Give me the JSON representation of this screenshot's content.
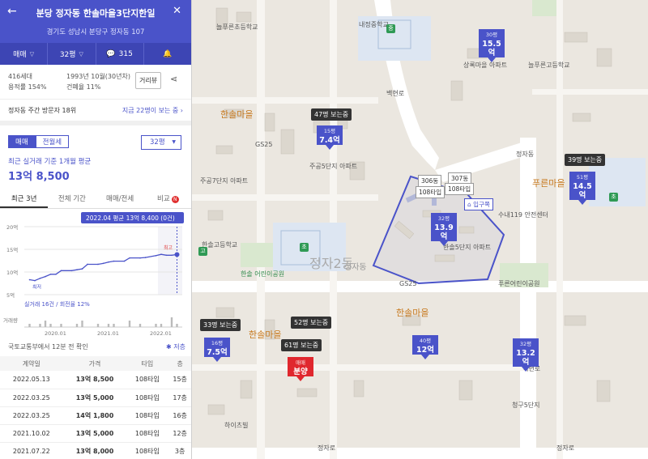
{
  "header": {
    "title": "분당 정자동 한솔마을3단지한일",
    "address": "경기도 성남시 분당구 정자동 107"
  },
  "toolbar": {
    "trade": "매매",
    "size": "32평",
    "comments": "315"
  },
  "info": {
    "units": "416세대",
    "floor_ratio": "용적률 154%",
    "built": "1993년 10월(30년차)",
    "coverage": "건폐율 11%",
    "street_view": "거리뷰"
  },
  "visitors": {
    "text": "정자동 주간 방문자 18위",
    "link": "지금 22명이 보는 중"
  },
  "deal_tabs": {
    "sale": "매매",
    "lease": "전월세",
    "size": "32평"
  },
  "summary": {
    "note": "최근 실거래 기준 1개월 평균",
    "price": "13억 8,500"
  },
  "period_tabs": [
    "최근 3년",
    "전체 기간",
    "매매/전세",
    "비교"
  ],
  "compare_badge": "N",
  "chart_data": {
    "type": "line",
    "tooltip": "2022.04 평균 13억 8,400 (0건)",
    "ylim": [
      5,
      20
    ],
    "yticks": [
      "20억",
      "15억",
      "10억",
      "5억"
    ],
    "xticks": [
      "2020.01",
      "2021.01",
      "2022.01"
    ],
    "x": [
      2019.5,
      2019.6,
      2019.7,
      2019.8,
      2019.9,
      2020.0,
      2020.1,
      2020.3,
      2020.4,
      2020.5,
      2020.6,
      2020.8,
      2020.9,
      2021.0,
      2021.1,
      2021.3,
      2021.4,
      2021.6,
      2021.7,
      2021.9,
      2022.0,
      2022.1,
      2022.2,
      2022.3
    ],
    "y": [
      8.3,
      8.1,
      8.6,
      9.0,
      9.5,
      9.5,
      10.3,
      10.3,
      10.5,
      10.7,
      11.7,
      11.7,
      11.9,
      12.2,
      12.4,
      12.4,
      13.1,
      13.1,
      13.2,
      13.6,
      13.9,
      13.7,
      13.7,
      13.85
    ],
    "highest": "최고",
    "lowest": "최저",
    "trade_count": "실거래 16건 / 회전율 12%",
    "volume_label": "거래량",
    "volume": [
      1,
      0,
      1,
      2,
      1,
      0,
      1,
      0,
      1,
      2,
      0,
      1,
      0,
      1,
      1,
      0,
      2,
      1,
      0,
      1,
      1,
      0,
      3,
      1
    ]
  },
  "source": {
    "text": "국토교통부에서 12분 전 확인",
    "link": "✱ 저층"
  },
  "deals": {
    "headers": [
      "계약일",
      "가격",
      "타입",
      "층"
    ],
    "rows": [
      [
        "2022.05.13",
        "13억 8,500",
        "108타입",
        "15층"
      ],
      [
        "2022.03.25",
        "13억 5,000",
        "108타입",
        "17층"
      ],
      [
        "2022.03.25",
        "14억 1,800",
        "108타입",
        "16층"
      ],
      [
        "2021.10.02",
        "13억 5,000",
        "108타입",
        "12층"
      ],
      [
        "2021.07.22",
        "13억 8,000",
        "108타입",
        "3층"
      ]
    ]
  },
  "map": {
    "district": "정자2동",
    "places": [
      "한솔마을",
      "한솔마을",
      "푸른마을",
      "한솔마을",
      "주공7단지\n아파트",
      "주공5단지\n아파트",
      "한솔고등학교",
      "한솔\n어린이공원",
      "늘푸른초등학교",
      "내정중학교",
      "상록마을\n아파트",
      "한솔5단지\n아파트",
      "늘푸른고등학교",
      "정자동",
      "하이츠빌",
      "청구5단지"
    ],
    "road_labels": [
      "GS25",
      "GS25",
      "수내119\n안전센터",
      "푸른어린이공원",
      "정자로",
      "정자로",
      "백현로",
      "백현로"
    ],
    "pins": [
      {
        "units": "15평",
        "price": "7.4억",
        "viewers": "47명 보는중"
      },
      {
        "units": "32평",
        "price": "13.9억",
        "viewers": ""
      },
      {
        "units": "30평",
        "price": "15.5억",
        "viewers": ""
      },
      {
        "units": "51평",
        "price": "14.5억",
        "viewers": "39명 보는중"
      },
      {
        "units": "16평",
        "price": "7.5억",
        "viewers": "33명 보는중"
      },
      {
        "units": "40평",
        "price": "12억",
        "viewers": ""
      },
      {
        "units": "32평",
        "price": "13.2억",
        "viewers": ""
      },
      {
        "units": "매매",
        "price": "분양",
        "viewers": "61명 보는중"
      }
    ],
    "extra_bubbles": [
      "52명 보는중"
    ],
    "buildings": [
      "306동",
      "307동",
      "108타입",
      "108타입"
    ],
    "entrance": "입구쪽"
  }
}
